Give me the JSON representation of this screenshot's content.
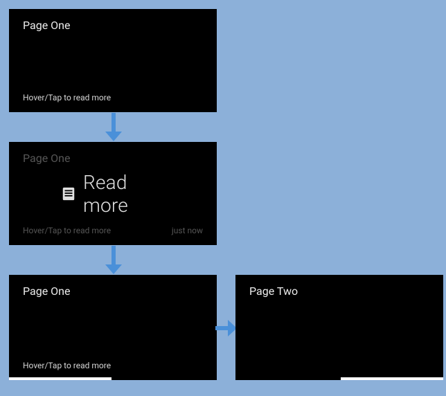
{
  "colors": {
    "background": "#8cb0d9",
    "card_bg": "#000000",
    "text_primary": "#ececec",
    "text_dim": "#565656",
    "arrow": "#4a90d9",
    "pagebar": "#ffffff"
  },
  "icons": {
    "document": "document-icon",
    "arrow_down": "arrow-down-icon",
    "arrow_right": "arrow-right-icon"
  },
  "cards": {
    "card1": {
      "title": "Page One",
      "hint": "Hover/Tap to read more"
    },
    "card2": {
      "title": "Page One",
      "hint": "Hover/Tap to read more",
      "readmore_label": "Read more",
      "timestamp": "just now"
    },
    "card3": {
      "title": "Page One",
      "hint": "Hover/Tap to read more"
    },
    "card4": {
      "title": "Page Two"
    }
  }
}
